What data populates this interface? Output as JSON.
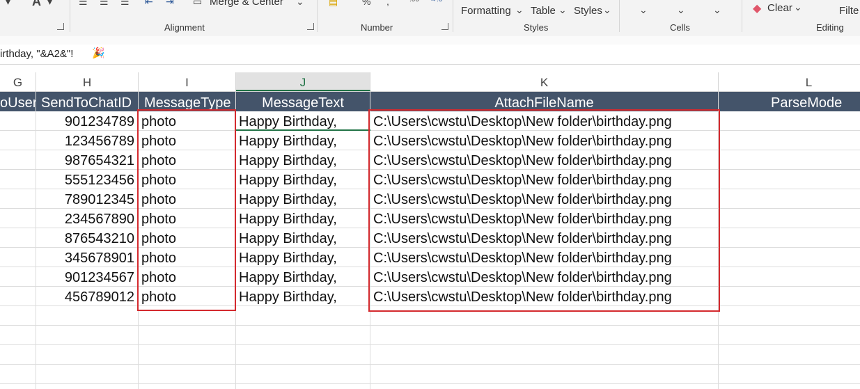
{
  "ribbon": {
    "alignment_label": "Alignment",
    "number_label": "Number",
    "styles_label": "Styles",
    "cells_label": "Cells",
    "editing_label": "Editing",
    "merge_center": "Merge & Center",
    "conditional_formatting": "Formatting",
    "format_as_table": "Table",
    "cell_styles": "Styles",
    "clear": "Clear",
    "filter": "Filte"
  },
  "formula_bar": {
    "text": "irthday, \"&A2&\"!"
  },
  "column_headers": [
    "G",
    "H",
    "I",
    "J",
    "K",
    "L"
  ],
  "table": {
    "headers": [
      "oUser",
      "SendToChatID",
      "MessageType",
      "MessageText",
      "AttachFileName",
      "ParseMode"
    ],
    "chat_ids": [
      "901234789",
      "123456789",
      "987654321",
      "555123456",
      "789012345",
      "234567890",
      "876543210",
      "345678901",
      "901234567",
      "456789012"
    ],
    "message_types": [
      "photo",
      "photo",
      "photo",
      "photo",
      "photo",
      "photo",
      "photo",
      "photo",
      "photo",
      "photo"
    ],
    "message_texts": [
      "Happy Birthday,",
      "Happy Birthday,",
      "Happy Birthday,",
      "Happy Birthday,",
      "Happy Birthday,",
      "Happy Birthday,",
      "Happy Birthday,",
      "Happy Birthday,",
      "Happy Birthday,",
      "Happy Birthday,"
    ],
    "attach_files": [
      "C:\\Users\\cwstu\\Desktop\\New folder\\birthday.png",
      "C:\\Users\\cwstu\\Desktop\\New folder\\birthday.png",
      "C:\\Users\\cwstu\\Desktop\\New folder\\birthday.png",
      "C:\\Users\\cwstu\\Desktop\\New folder\\birthday.png",
      "C:\\Users\\cwstu\\Desktop\\New folder\\birthday.png",
      "C:\\Users\\cwstu\\Desktop\\New folder\\birthday.png",
      "C:\\Users\\cwstu\\Desktop\\New folder\\birthday.png",
      "C:\\Users\\cwstu\\Desktop\\New folder\\birthday.png",
      "C:\\Users\\cwstu\\Desktop\\New folder\\birthday.png",
      "C:\\Users\\cwstu\\Desktop\\New folder\\birthday.png"
    ]
  },
  "colors": {
    "header_fill": "#44546a",
    "highlight": "#d42a2e",
    "excel_green": "#217346"
  }
}
